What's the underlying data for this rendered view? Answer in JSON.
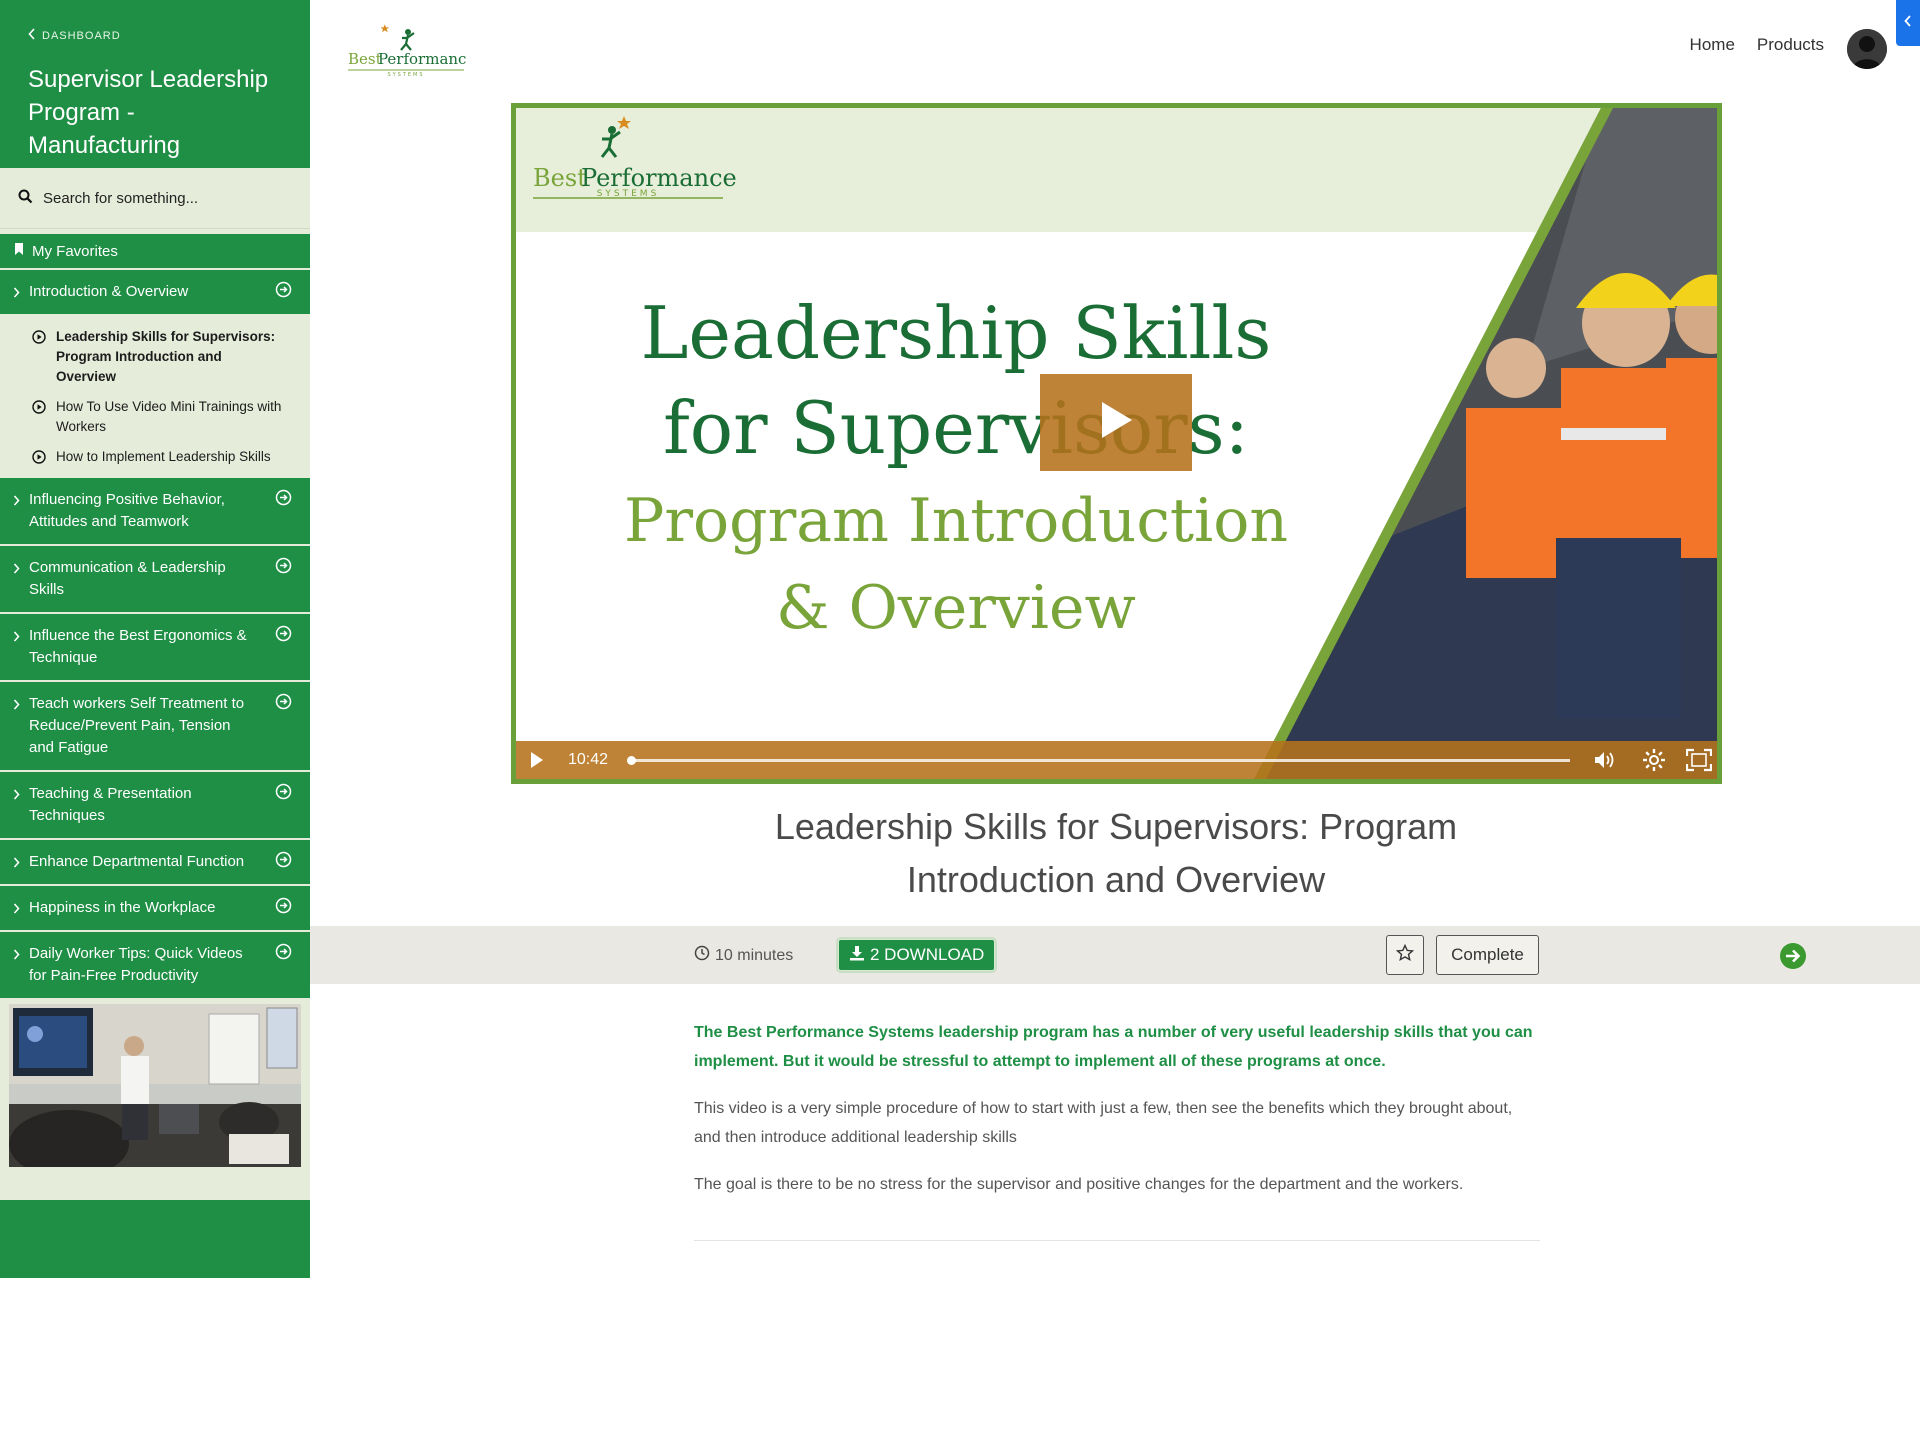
{
  "sidebar": {
    "back_label": "DASHBOARD",
    "course_title": "Supervisor Leadership Program - Manufacturing",
    "search_placeholder": "Search for something...",
    "favorites_label": "My Favorites",
    "sections": [
      {
        "label": "Introduction & Overview",
        "expanded": true,
        "lessons": [
          {
            "label": "Leadership Skills for Supervisors: Program Introduction and Overview",
            "active": true
          },
          {
            "label": "How To Use Video Mini Trainings with Workers",
            "active": false
          },
          {
            "label": "How to Implement Leadership Skills",
            "active": false
          }
        ]
      },
      {
        "label": "Influencing Positive Behavior, Attitudes and Teamwork"
      },
      {
        "label": "Communication & Leadership Skills"
      },
      {
        "label": "Influence the Best Ergonomics & Technique"
      },
      {
        "label": "Teach workers Self Treatment to Reduce/Prevent Pain, Tension and Fatigue"
      },
      {
        "label": "Teaching & Presentation Techniques"
      },
      {
        "label": "Enhance Departmental Function"
      },
      {
        "label": "Happiness in the Workplace"
      },
      {
        "label": "Daily Worker Tips: Quick Videos for Pain-Free Productivity"
      }
    ]
  },
  "header": {
    "logo_text_best": "Best",
    "logo_text_performance": "Performance",
    "logo_sub": "SYSTEMS",
    "nav": [
      "Home",
      "Products"
    ]
  },
  "video": {
    "logo_best": "Best",
    "logo_performance": "Performance",
    "logo_sub": "SYSTEMS",
    "title_line1": "Leadership Skills",
    "title_line2": "for Supervisors:",
    "title_line3": "Program Introduction",
    "title_line4": "& Overview",
    "duration": "10:42",
    "progress": 0
  },
  "lesson": {
    "title": "Leadership Skills for Supervisors: Program Introduction and Overview",
    "duration": "10 minutes",
    "download_label": "2 DOWNLOAD",
    "complete_label": "Complete"
  },
  "description": {
    "lead": "The Best Performance Systems leadership program has a number of very useful leadership skills that you can implement. But it would be stressful to attempt to implement all of these programs at once.",
    "p1": "This video is a very simple procedure of how to start with just a few, then see the benefits which they brought about, and then introduce additional leadership skills",
    "p2": "The goal is there to be no stress for the supervisor and positive changes for the department and the workers."
  },
  "colors": {
    "brand_green": "#1e8f45",
    "sidebar_bg": "#e6ecda",
    "video_accent": "#b5721b",
    "light_green": "#79a43a"
  }
}
